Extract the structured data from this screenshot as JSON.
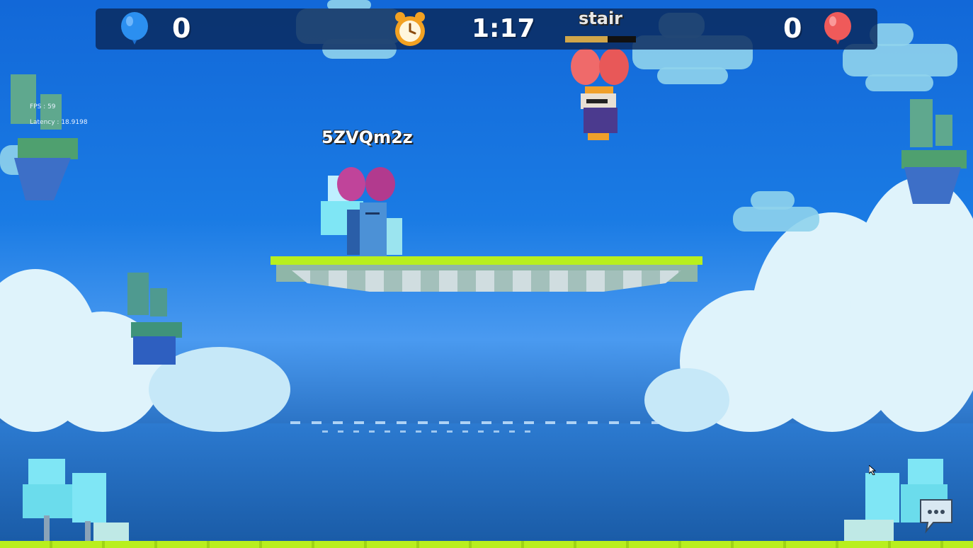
{
  "hud": {
    "blue_score": "0",
    "red_score": "0",
    "timer": "1:17",
    "blue_balloon_icon": "blue-balloon-icon",
    "red_balloon_icon": "red-balloon-icon",
    "clock_icon": "alarm-clock-icon"
  },
  "players": {
    "local_name": "5ZVQm2z",
    "opponent_name": "stair",
    "opponent_health_fraction": 0.6
  },
  "debug": {
    "fps": "FPS : 59",
    "latency": "Latency : 18.9198"
  },
  "colors": {
    "blue_team": "#2b8ff0",
    "red_team": "#ef5a5a",
    "grass": "#b8ef1e",
    "local_balloon": "#c0449a"
  },
  "chat_icon": "chat-bubble-icon"
}
